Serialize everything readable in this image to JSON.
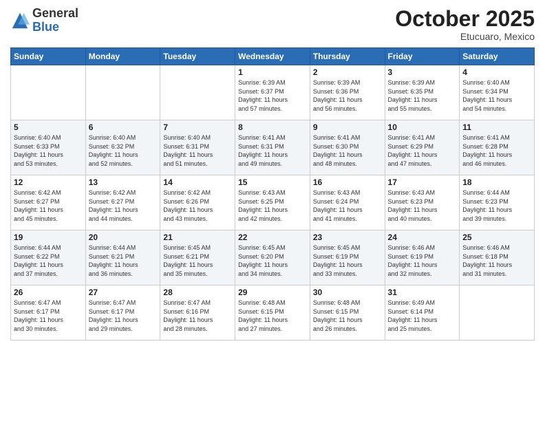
{
  "logo": {
    "general": "General",
    "blue": "Blue"
  },
  "header": {
    "month": "October 2025",
    "location": "Etucuaro, Mexico"
  },
  "days_of_week": [
    "Sunday",
    "Monday",
    "Tuesday",
    "Wednesday",
    "Thursday",
    "Friday",
    "Saturday"
  ],
  "weeks": [
    [
      {
        "day": "",
        "info": ""
      },
      {
        "day": "",
        "info": ""
      },
      {
        "day": "",
        "info": ""
      },
      {
        "day": "1",
        "info": "Sunrise: 6:39 AM\nSunset: 6:37 PM\nDaylight: 11 hours\nand 57 minutes."
      },
      {
        "day": "2",
        "info": "Sunrise: 6:39 AM\nSunset: 6:36 PM\nDaylight: 11 hours\nand 56 minutes."
      },
      {
        "day": "3",
        "info": "Sunrise: 6:39 AM\nSunset: 6:35 PM\nDaylight: 11 hours\nand 55 minutes."
      },
      {
        "day": "4",
        "info": "Sunrise: 6:40 AM\nSunset: 6:34 PM\nDaylight: 11 hours\nand 54 minutes."
      }
    ],
    [
      {
        "day": "5",
        "info": "Sunrise: 6:40 AM\nSunset: 6:33 PM\nDaylight: 11 hours\nand 53 minutes."
      },
      {
        "day": "6",
        "info": "Sunrise: 6:40 AM\nSunset: 6:32 PM\nDaylight: 11 hours\nand 52 minutes."
      },
      {
        "day": "7",
        "info": "Sunrise: 6:40 AM\nSunset: 6:31 PM\nDaylight: 11 hours\nand 51 minutes."
      },
      {
        "day": "8",
        "info": "Sunrise: 6:41 AM\nSunset: 6:31 PM\nDaylight: 11 hours\nand 49 minutes."
      },
      {
        "day": "9",
        "info": "Sunrise: 6:41 AM\nSunset: 6:30 PM\nDaylight: 11 hours\nand 48 minutes."
      },
      {
        "day": "10",
        "info": "Sunrise: 6:41 AM\nSunset: 6:29 PM\nDaylight: 11 hours\nand 47 minutes."
      },
      {
        "day": "11",
        "info": "Sunrise: 6:41 AM\nSunset: 6:28 PM\nDaylight: 11 hours\nand 46 minutes."
      }
    ],
    [
      {
        "day": "12",
        "info": "Sunrise: 6:42 AM\nSunset: 6:27 PM\nDaylight: 11 hours\nand 45 minutes."
      },
      {
        "day": "13",
        "info": "Sunrise: 6:42 AM\nSunset: 6:27 PM\nDaylight: 11 hours\nand 44 minutes."
      },
      {
        "day": "14",
        "info": "Sunrise: 6:42 AM\nSunset: 6:26 PM\nDaylight: 11 hours\nand 43 minutes."
      },
      {
        "day": "15",
        "info": "Sunrise: 6:43 AM\nSunset: 6:25 PM\nDaylight: 11 hours\nand 42 minutes."
      },
      {
        "day": "16",
        "info": "Sunrise: 6:43 AM\nSunset: 6:24 PM\nDaylight: 11 hours\nand 41 minutes."
      },
      {
        "day": "17",
        "info": "Sunrise: 6:43 AM\nSunset: 6:23 PM\nDaylight: 11 hours\nand 40 minutes."
      },
      {
        "day": "18",
        "info": "Sunrise: 6:44 AM\nSunset: 6:23 PM\nDaylight: 11 hours\nand 39 minutes."
      }
    ],
    [
      {
        "day": "19",
        "info": "Sunrise: 6:44 AM\nSunset: 6:22 PM\nDaylight: 11 hours\nand 37 minutes."
      },
      {
        "day": "20",
        "info": "Sunrise: 6:44 AM\nSunset: 6:21 PM\nDaylight: 11 hours\nand 36 minutes."
      },
      {
        "day": "21",
        "info": "Sunrise: 6:45 AM\nSunset: 6:21 PM\nDaylight: 11 hours\nand 35 minutes."
      },
      {
        "day": "22",
        "info": "Sunrise: 6:45 AM\nSunset: 6:20 PM\nDaylight: 11 hours\nand 34 minutes."
      },
      {
        "day": "23",
        "info": "Sunrise: 6:45 AM\nSunset: 6:19 PM\nDaylight: 11 hours\nand 33 minutes."
      },
      {
        "day": "24",
        "info": "Sunrise: 6:46 AM\nSunset: 6:19 PM\nDaylight: 11 hours\nand 32 minutes."
      },
      {
        "day": "25",
        "info": "Sunrise: 6:46 AM\nSunset: 6:18 PM\nDaylight: 11 hours\nand 31 minutes."
      }
    ],
    [
      {
        "day": "26",
        "info": "Sunrise: 6:47 AM\nSunset: 6:17 PM\nDaylight: 11 hours\nand 30 minutes."
      },
      {
        "day": "27",
        "info": "Sunrise: 6:47 AM\nSunset: 6:17 PM\nDaylight: 11 hours\nand 29 minutes."
      },
      {
        "day": "28",
        "info": "Sunrise: 6:47 AM\nSunset: 6:16 PM\nDaylight: 11 hours\nand 28 minutes."
      },
      {
        "day": "29",
        "info": "Sunrise: 6:48 AM\nSunset: 6:15 PM\nDaylight: 11 hours\nand 27 minutes."
      },
      {
        "day": "30",
        "info": "Sunrise: 6:48 AM\nSunset: 6:15 PM\nDaylight: 11 hours\nand 26 minutes."
      },
      {
        "day": "31",
        "info": "Sunrise: 6:49 AM\nSunset: 6:14 PM\nDaylight: 11 hours\nand 25 minutes."
      },
      {
        "day": "",
        "info": ""
      }
    ]
  ]
}
